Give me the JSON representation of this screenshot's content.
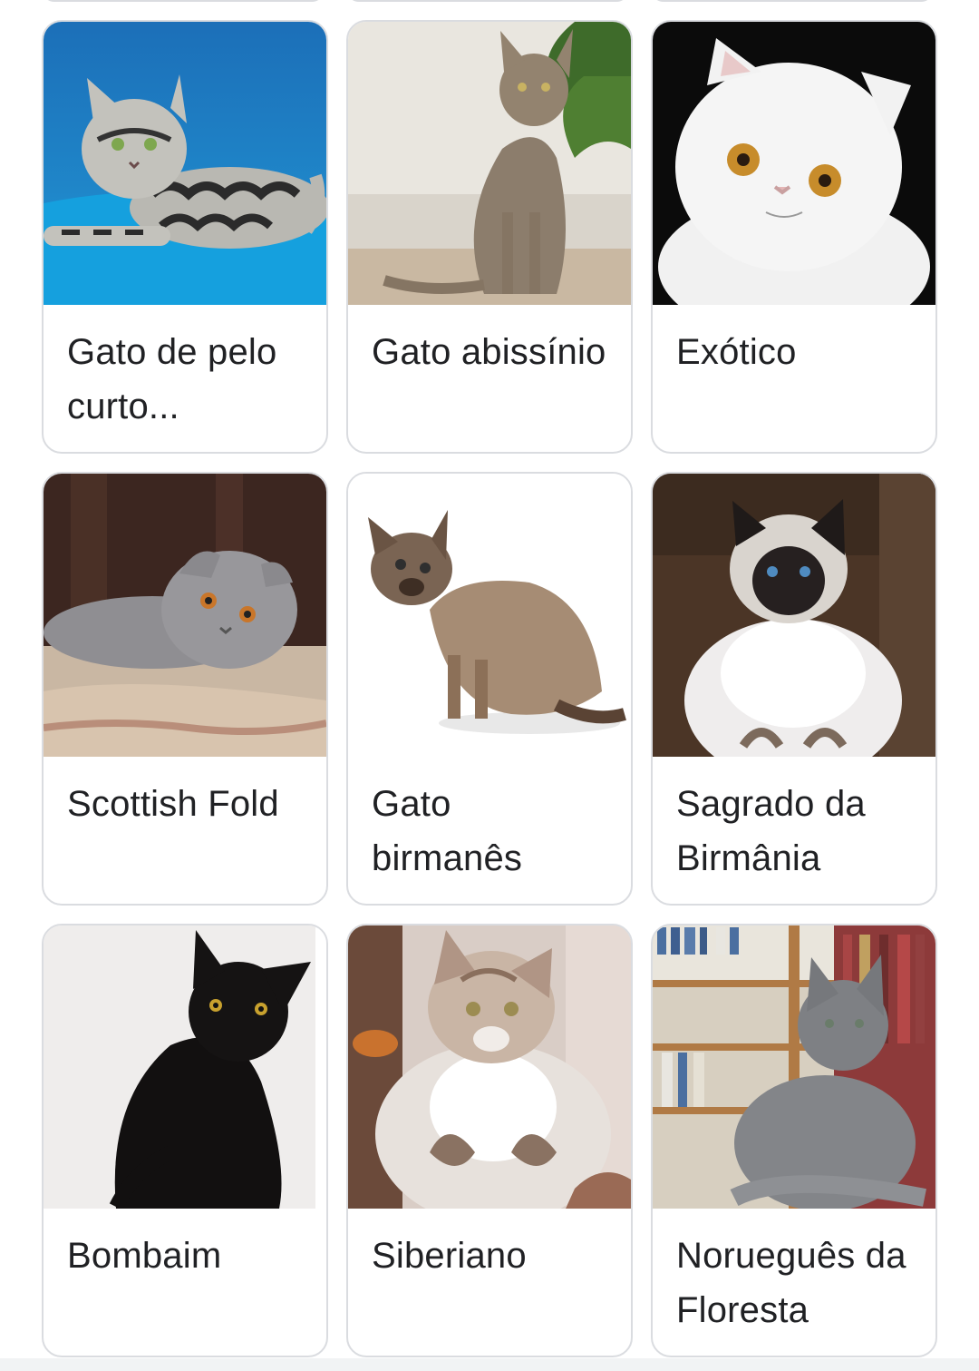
{
  "results": [
    {
      "label": "Gato de pelo curto...",
      "image_desc_icon": "american-shorthair-cat-photo"
    },
    {
      "label": "Gato abissínio",
      "image_desc_icon": "abyssinian-cat-photo"
    },
    {
      "label": "Exótico",
      "image_desc_icon": "exotic-shorthair-cat-photo"
    },
    {
      "label": "Scottish Fold",
      "image_desc_icon": "scottish-fold-cat-photo"
    },
    {
      "label": "Gato birmanês",
      "image_desc_icon": "burmese-cat-photo"
    },
    {
      "label": "Sagrado da Birmânia",
      "image_desc_icon": "birman-cat-photo"
    },
    {
      "label": "Bombaim",
      "image_desc_icon": "bombay-cat-photo"
    },
    {
      "label": "Siberiano",
      "image_desc_icon": "siberian-cat-photo"
    },
    {
      "label": "Norueguês da Floresta",
      "image_desc_icon": "norwegian-forest-cat-photo"
    }
  ],
  "colors": {
    "card_border": "#dadce0",
    "label_text": "#202124",
    "background": "#ffffff"
  }
}
